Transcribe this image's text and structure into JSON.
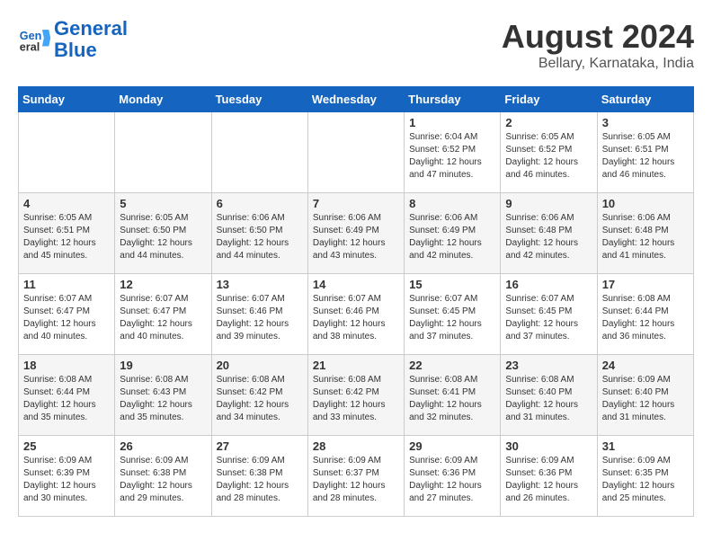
{
  "header": {
    "logo_line1": "General",
    "logo_line2": "Blue",
    "month_year": "August 2024",
    "location": "Bellary, Karnataka, India"
  },
  "days_of_week": [
    "Sunday",
    "Monday",
    "Tuesday",
    "Wednesday",
    "Thursday",
    "Friday",
    "Saturday"
  ],
  "weeks": [
    {
      "days": [
        {
          "num": "",
          "info": ""
        },
        {
          "num": "",
          "info": ""
        },
        {
          "num": "",
          "info": ""
        },
        {
          "num": "",
          "info": ""
        },
        {
          "num": "1",
          "info": "Sunrise: 6:04 AM\nSunset: 6:52 PM\nDaylight: 12 hours\nand 47 minutes."
        },
        {
          "num": "2",
          "info": "Sunrise: 6:05 AM\nSunset: 6:52 PM\nDaylight: 12 hours\nand 46 minutes."
        },
        {
          "num": "3",
          "info": "Sunrise: 6:05 AM\nSunset: 6:51 PM\nDaylight: 12 hours\nand 46 minutes."
        }
      ]
    },
    {
      "days": [
        {
          "num": "4",
          "info": "Sunrise: 6:05 AM\nSunset: 6:51 PM\nDaylight: 12 hours\nand 45 minutes."
        },
        {
          "num": "5",
          "info": "Sunrise: 6:05 AM\nSunset: 6:50 PM\nDaylight: 12 hours\nand 44 minutes."
        },
        {
          "num": "6",
          "info": "Sunrise: 6:06 AM\nSunset: 6:50 PM\nDaylight: 12 hours\nand 44 minutes."
        },
        {
          "num": "7",
          "info": "Sunrise: 6:06 AM\nSunset: 6:49 PM\nDaylight: 12 hours\nand 43 minutes."
        },
        {
          "num": "8",
          "info": "Sunrise: 6:06 AM\nSunset: 6:49 PM\nDaylight: 12 hours\nand 42 minutes."
        },
        {
          "num": "9",
          "info": "Sunrise: 6:06 AM\nSunset: 6:48 PM\nDaylight: 12 hours\nand 42 minutes."
        },
        {
          "num": "10",
          "info": "Sunrise: 6:06 AM\nSunset: 6:48 PM\nDaylight: 12 hours\nand 41 minutes."
        }
      ]
    },
    {
      "days": [
        {
          "num": "11",
          "info": "Sunrise: 6:07 AM\nSunset: 6:47 PM\nDaylight: 12 hours\nand 40 minutes."
        },
        {
          "num": "12",
          "info": "Sunrise: 6:07 AM\nSunset: 6:47 PM\nDaylight: 12 hours\nand 40 minutes."
        },
        {
          "num": "13",
          "info": "Sunrise: 6:07 AM\nSunset: 6:46 PM\nDaylight: 12 hours\nand 39 minutes."
        },
        {
          "num": "14",
          "info": "Sunrise: 6:07 AM\nSunset: 6:46 PM\nDaylight: 12 hours\nand 38 minutes."
        },
        {
          "num": "15",
          "info": "Sunrise: 6:07 AM\nSunset: 6:45 PM\nDaylight: 12 hours\nand 37 minutes."
        },
        {
          "num": "16",
          "info": "Sunrise: 6:07 AM\nSunset: 6:45 PM\nDaylight: 12 hours\nand 37 minutes."
        },
        {
          "num": "17",
          "info": "Sunrise: 6:08 AM\nSunset: 6:44 PM\nDaylight: 12 hours\nand 36 minutes."
        }
      ]
    },
    {
      "days": [
        {
          "num": "18",
          "info": "Sunrise: 6:08 AM\nSunset: 6:44 PM\nDaylight: 12 hours\nand 35 minutes."
        },
        {
          "num": "19",
          "info": "Sunrise: 6:08 AM\nSunset: 6:43 PM\nDaylight: 12 hours\nand 35 minutes."
        },
        {
          "num": "20",
          "info": "Sunrise: 6:08 AM\nSunset: 6:42 PM\nDaylight: 12 hours\nand 34 minutes."
        },
        {
          "num": "21",
          "info": "Sunrise: 6:08 AM\nSunset: 6:42 PM\nDaylight: 12 hours\nand 33 minutes."
        },
        {
          "num": "22",
          "info": "Sunrise: 6:08 AM\nSunset: 6:41 PM\nDaylight: 12 hours\nand 32 minutes."
        },
        {
          "num": "23",
          "info": "Sunrise: 6:08 AM\nSunset: 6:40 PM\nDaylight: 12 hours\nand 31 minutes."
        },
        {
          "num": "24",
          "info": "Sunrise: 6:09 AM\nSunset: 6:40 PM\nDaylight: 12 hours\nand 31 minutes."
        }
      ]
    },
    {
      "days": [
        {
          "num": "25",
          "info": "Sunrise: 6:09 AM\nSunset: 6:39 PM\nDaylight: 12 hours\nand 30 minutes."
        },
        {
          "num": "26",
          "info": "Sunrise: 6:09 AM\nSunset: 6:38 PM\nDaylight: 12 hours\nand 29 minutes."
        },
        {
          "num": "27",
          "info": "Sunrise: 6:09 AM\nSunset: 6:38 PM\nDaylight: 12 hours\nand 28 minutes."
        },
        {
          "num": "28",
          "info": "Sunrise: 6:09 AM\nSunset: 6:37 PM\nDaylight: 12 hours\nand 28 minutes."
        },
        {
          "num": "29",
          "info": "Sunrise: 6:09 AM\nSunset: 6:36 PM\nDaylight: 12 hours\nand 27 minutes."
        },
        {
          "num": "30",
          "info": "Sunrise: 6:09 AM\nSunset: 6:36 PM\nDaylight: 12 hours\nand 26 minutes."
        },
        {
          "num": "31",
          "info": "Sunrise: 6:09 AM\nSunset: 6:35 PM\nDaylight: 12 hours\nand 25 minutes."
        }
      ]
    }
  ]
}
